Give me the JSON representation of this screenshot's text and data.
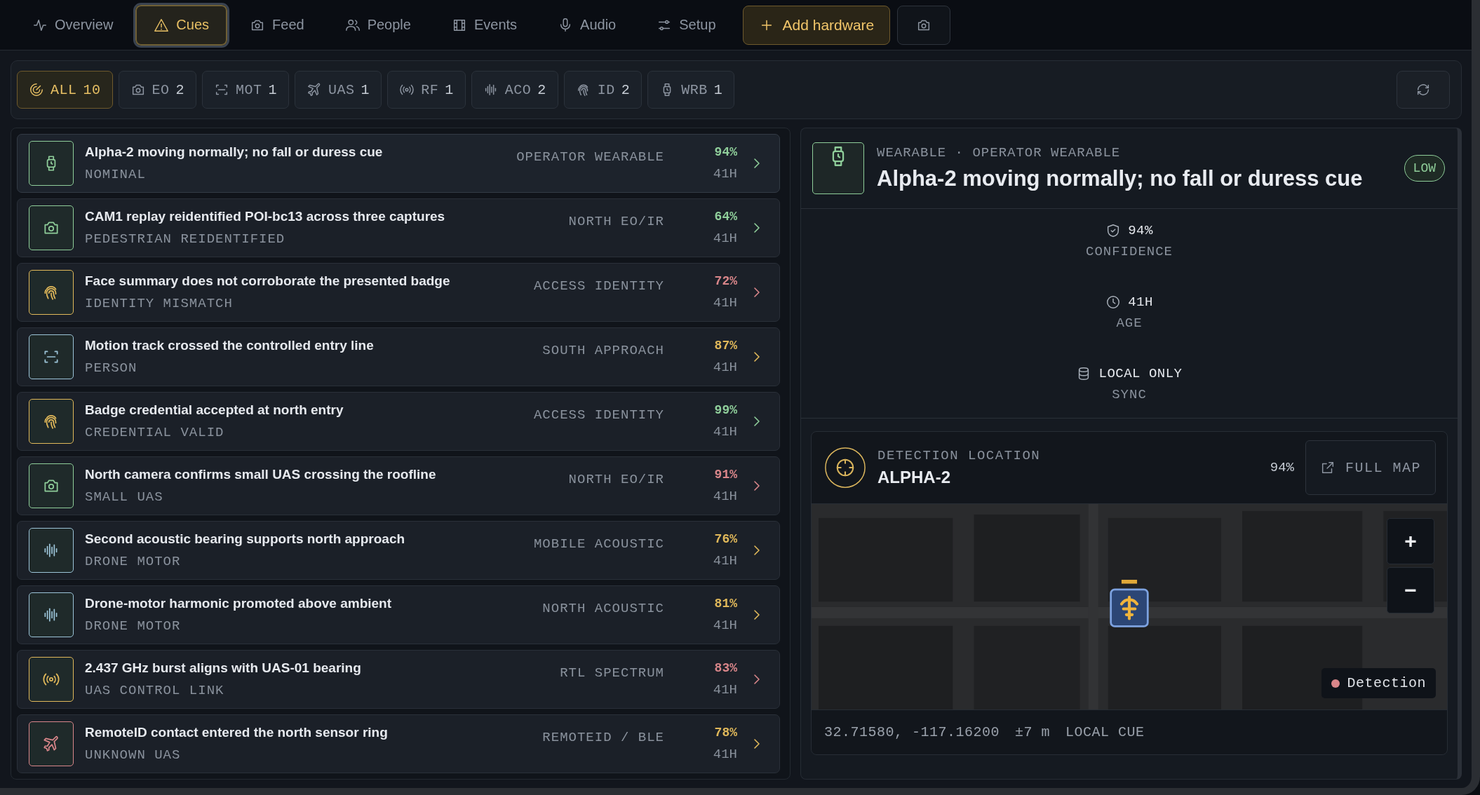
{
  "nav": {
    "tabs": [
      {
        "label": "Overview",
        "selected": false
      },
      {
        "label": "Cues",
        "selected": true
      },
      {
        "label": "Feed",
        "selected": false
      },
      {
        "label": "People",
        "selected": false
      },
      {
        "label": "Events",
        "selected": false
      },
      {
        "label": "Audio",
        "selected": false
      },
      {
        "label": "Setup",
        "selected": false
      }
    ],
    "add_button": "Add hardware"
  },
  "filters": [
    {
      "label": "ALL",
      "count": "10",
      "selected": true
    },
    {
      "label": "EO",
      "count": "2",
      "selected": false
    },
    {
      "label": "MOT",
      "count": "1",
      "selected": false
    },
    {
      "label": "UAS",
      "count": "1",
      "selected": false
    },
    {
      "label": "RF",
      "count": "1",
      "selected": false
    },
    {
      "label": "ACO",
      "count": "2",
      "selected": false
    },
    {
      "label": "ID",
      "count": "2",
      "selected": false
    },
    {
      "label": "WRB",
      "count": "1",
      "selected": false
    }
  ],
  "cues": [
    {
      "kind": "wearable",
      "color": "#8fce9a",
      "title": "Alpha-2 moving normally; no fall or duress cue",
      "subtitle": "NOMINAL",
      "source": "OPERATOR WEARABLE",
      "confidence": {
        "text": "94%",
        "color": "#8fce9a"
      },
      "age": "41H",
      "selected": true
    },
    {
      "kind": "camera",
      "color": "#8fce9a",
      "title": "CAM1 replay reidentified POI-bc13 across three captures",
      "subtitle": "PEDESTRIAN REIDENTIFIED",
      "source": "NORTH EO/IR",
      "confidence": {
        "text": "64%",
        "color": "#8fce9a"
      },
      "age": "41H",
      "selected": false
    },
    {
      "kind": "identity",
      "color": "#e0b85a",
      "title": "Face summary does not corroborate the presented badge",
      "subtitle": "IDENTITY MISMATCH",
      "source": "ACCESS IDENTITY",
      "confidence": {
        "text": "72%",
        "color": "#d9868a"
      },
      "age": "41H",
      "selected": false
    },
    {
      "kind": "motion",
      "color": "#9cc4d8",
      "title": "Motion track crossed the controlled entry line",
      "subtitle": "PERSON",
      "source": "SOUTH APPROACH",
      "confidence": {
        "text": "87%",
        "color": "#e0b85a"
      },
      "age": "41H",
      "selected": false
    },
    {
      "kind": "identity",
      "color": "#e0b85a",
      "title": "Badge credential accepted at north entry",
      "subtitle": "CREDENTIAL VALID",
      "source": "ACCESS IDENTITY",
      "confidence": {
        "text": "99%",
        "color": "#8fce9a"
      },
      "age": "41H",
      "selected": false
    },
    {
      "kind": "camera",
      "color": "#8fce9a",
      "title": "North camera confirms small UAS crossing the roofline",
      "subtitle": "SMALL UAS",
      "source": "NORTH EO/IR",
      "confidence": {
        "text": "91%",
        "color": "#d9868a"
      },
      "age": "41H",
      "selected": false
    },
    {
      "kind": "acoustic",
      "color": "#9cc4d8",
      "title": "Second acoustic bearing supports north approach",
      "subtitle": "DRONE MOTOR",
      "source": "MOBILE ACOUSTIC",
      "confidence": {
        "text": "76%",
        "color": "#e0b85a"
      },
      "age": "41H",
      "selected": false
    },
    {
      "kind": "acoustic",
      "color": "#9cc4d8",
      "title": "Drone-motor harmonic promoted above ambient",
      "subtitle": "DRONE MOTOR",
      "source": "NORTH ACOUSTIC",
      "confidence": {
        "text": "81%",
        "color": "#e0b85a"
      },
      "age": "41H",
      "selected": false
    },
    {
      "kind": "rf",
      "color": "#e0b85a",
      "title": "2.437 GHz burst aligns with UAS-01 bearing",
      "subtitle": "UAS CONTROL LINK",
      "source": "RTL SPECTRUM",
      "confidence": {
        "text": "83%",
        "color": "#d9868a"
      },
      "age": "41H",
      "selected": false
    },
    {
      "kind": "uas",
      "color": "#d9868a",
      "title": "RemoteID contact entered the north sensor ring",
      "subtitle": "UNKNOWN UAS",
      "source": "REMOTEID / BLE",
      "confidence": {
        "text": "78%",
        "color": "#e0b85a"
      },
      "age": "41H",
      "selected": false
    }
  ],
  "detail": {
    "kind": "wearable",
    "color": "#8fce9a",
    "category": "WEARABLE · OPERATOR WEARABLE",
    "title": "Alpha-2 moving normally; no fall or duress cue",
    "severity": "LOW",
    "stats": [
      {
        "value": "94%",
        "label": "CONFIDENCE"
      },
      {
        "value": "41H",
        "label": "AGE"
      },
      {
        "value": "LOCAL ONLY",
        "label": "SYNC"
      }
    ],
    "location": {
      "label": "DETECTION LOCATION",
      "name": "ALPHA-2",
      "confidence": "94%",
      "map_button": "FULL MAP",
      "zoom_in": "+",
      "zoom_out": "−",
      "legend": {
        "label": "Detection",
        "color": "#d9868a"
      },
      "coordinates": "32.71580, -117.16200",
      "accuracy": "±7 m",
      "scope": "LOCAL CUE"
    }
  }
}
